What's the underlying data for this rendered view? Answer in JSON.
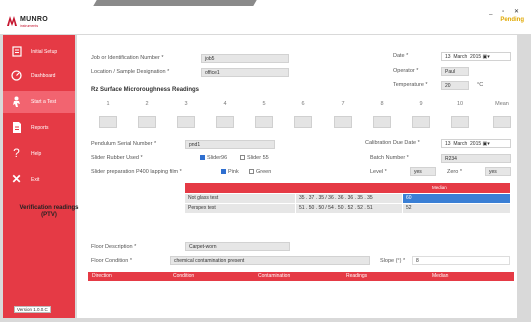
{
  "app": {
    "brand": "MUNRO",
    "brand_sub": "instruments",
    "status": "Pending",
    "window_controls": "_ ▫ ✕",
    "version": "Version 1.0.0.C"
  },
  "sidebar": {
    "items": [
      {
        "label": "Initial Setup",
        "icon": "clipboard-icon"
      },
      {
        "label": "Dashboard",
        "icon": "dashboard-icon"
      },
      {
        "label": "Start a Test",
        "icon": "person-icon"
      },
      {
        "label": "Reports",
        "icon": "report-icon"
      },
      {
        "label": "Help",
        "icon": "help-icon"
      },
      {
        "label": "Exit",
        "icon": "close-icon"
      }
    ]
  },
  "form": {
    "job_label": "Job or Identification Number",
    "job_value": "job5",
    "location_label": "Location / Sample Designation",
    "location_value": "office1",
    "date_label": "Date",
    "date_day": "13",
    "date_month": "March",
    "date_year": "2015",
    "operator_label": "Operator",
    "operator_value": "Paul",
    "temperature_label": "Temperature",
    "temperature_value": "20",
    "temperature_unit": "°C",
    "rz_title": "Rz Surface Microroughness Readings",
    "readings": [
      "1",
      "2",
      "3",
      "4",
      "5",
      "6",
      "7",
      "8",
      "9",
      "10",
      "Mean"
    ],
    "pendulum_label": "Pendulum Serial Number",
    "pendulum_value": "pnd1",
    "calibration_label": "Calibration Due Date",
    "cal_day": "13",
    "cal_month": "March",
    "cal_year": "2015",
    "slider_label": "Slider Rubber Used",
    "slider_opt1": "Slider96",
    "slider_opt2": "Slider 55",
    "batch_label": "Batch Number",
    "batch_value": "R234",
    "prep_label": "Slider preparation P400 lapping film",
    "prep_opt1": "Pink",
    "prep_opt2": "Green",
    "level_label": "Level",
    "level_value": "yes",
    "zero_label": "Zero",
    "zero_value": "yes"
  },
  "verification": {
    "title": "Verification readings (PTV)",
    "median_header": "Median",
    "rows": [
      {
        "label": "Not glass test",
        "values": "35 . 37 . 35 / 36 . 36 . 36 . 35 . 35",
        "median": "60"
      },
      {
        "label": "Perspex test",
        "values": "51 . 50 . 50 / 54 . 50 . 52 . 52 . 51",
        "median": "52"
      }
    ]
  },
  "floor": {
    "description_label": "Floor Description",
    "description_value": "Carpet-worn",
    "condition_label": "Floor Condition",
    "condition_value": "chemical contamination present",
    "slope_label": "Slope (°)",
    "slope_value": "8"
  },
  "bottom_table": {
    "columns": [
      "Direction",
      "Condition",
      "Contamination",
      "Readings",
      "Median"
    ]
  }
}
